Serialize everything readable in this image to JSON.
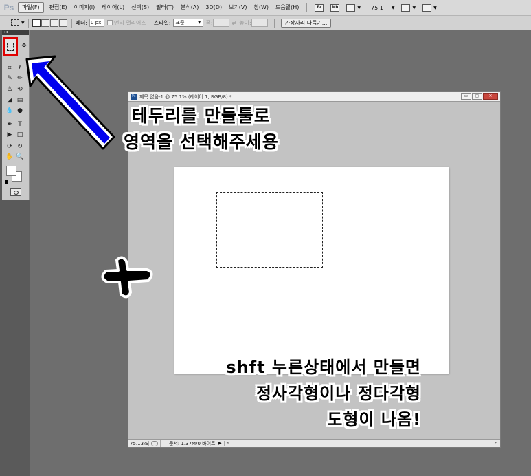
{
  "menubar": {
    "logo": "Ps",
    "items": [
      "파일(F)",
      "편집(E)",
      "이미지(I)",
      "레이어(L)",
      "선택(S)",
      "필터(T)",
      "분석(A)",
      "3D(D)",
      "보기(V)",
      "창(W)",
      "도움말(H)"
    ],
    "bridge_icon": "Br",
    "minibridge_icon": "Mb",
    "zoom": "75.1"
  },
  "options": {
    "feather_label": "페더:",
    "feather_value": "0 px",
    "antialias_label": "앤티 앨리어스",
    "style_label": "스타일:",
    "style_value": "표준",
    "width_label": "폭:",
    "height_label": "높이:",
    "refine_edge_button": "가장자리 다듬기..."
  },
  "document": {
    "title": "제목 없음-1 @ 75.1% (레이어 1, RGB/8) *",
    "status_zoom": "75.13%",
    "status_info": "문서: 1.37M/0 바이트"
  },
  "annotations": {
    "top_line1": "테두리를 만들툴로",
    "top_line2": "영역을 선택해주세용",
    "bottom_line1": "shft 누른상태에서 만들면",
    "bottom_line2": "정사각형이나 정다각형",
    "bottom_line3": "도형이 나옴!",
    "plus": "+"
  },
  "colors": {
    "highlight": "#e00000",
    "arrow": "#0000ee"
  }
}
